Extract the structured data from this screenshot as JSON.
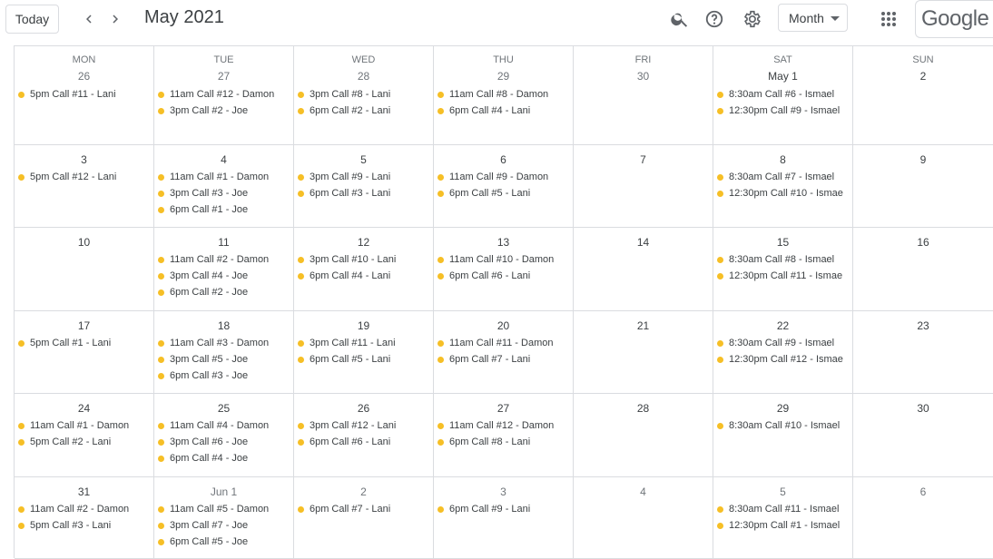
{
  "header": {
    "today_label": "Today",
    "title": "May 2021",
    "view_label": "Month",
    "logo_text": "Google",
    "prev_icon": "chevron-left-icon",
    "next_icon": "chevron-right-icon",
    "search_icon": "search-icon",
    "help_icon": "help-icon",
    "settings_icon": "gear-icon",
    "apps_icon": "apps-grid-icon"
  },
  "colors": {
    "event_dot": "#f6bf26",
    "grid_line": "#dadce0"
  },
  "weekdays": [
    "MON",
    "TUE",
    "WED",
    "THU",
    "FRI",
    "SAT",
    "SUN"
  ],
  "weeks": [
    {
      "days": [
        {
          "label": "26",
          "other": true,
          "events": [
            {
              "time": "5pm",
              "title": "Call #11 - Lani"
            }
          ]
        },
        {
          "label": "27",
          "other": true,
          "events": [
            {
              "time": "11am",
              "title": "Call #12 - Damon"
            },
            {
              "time": "3pm",
              "title": "Call #2 - Joe"
            }
          ]
        },
        {
          "label": "28",
          "other": true,
          "events": [
            {
              "time": "3pm",
              "title": "Call #8 - Lani"
            },
            {
              "time": "6pm",
              "title": "Call #2 - Lani"
            }
          ]
        },
        {
          "label": "29",
          "other": true,
          "events": [
            {
              "time": "11am",
              "title": "Call #8 - Damon"
            },
            {
              "time": "6pm",
              "title": "Call #4 - Lani"
            }
          ]
        },
        {
          "label": "30",
          "other": true,
          "events": []
        },
        {
          "label": "May 1",
          "other": false,
          "events": [
            {
              "time": "8:30am",
              "title": "Call #6 - Ismael"
            },
            {
              "time": "12:30pm",
              "title": "Call #9 - Ismael"
            }
          ]
        },
        {
          "label": "2",
          "other": false,
          "events": []
        }
      ]
    },
    {
      "days": [
        {
          "label": "3",
          "other": false,
          "events": [
            {
              "time": "5pm",
              "title": "Call #12 - Lani"
            }
          ]
        },
        {
          "label": "4",
          "other": false,
          "events": [
            {
              "time": "11am",
              "title": "Call #1 - Damon"
            },
            {
              "time": "3pm",
              "title": "Call #3 - Joe"
            },
            {
              "time": "6pm",
              "title": "Call #1 - Joe"
            }
          ]
        },
        {
          "label": "5",
          "other": false,
          "events": [
            {
              "time": "3pm",
              "title": "Call #9 - Lani"
            },
            {
              "time": "6pm",
              "title": "Call #3 - Lani"
            }
          ]
        },
        {
          "label": "6",
          "other": false,
          "events": [
            {
              "time": "11am",
              "title": "Call #9 - Damon"
            },
            {
              "time": "6pm",
              "title": "Call #5 - Lani"
            }
          ]
        },
        {
          "label": "7",
          "other": false,
          "events": []
        },
        {
          "label": "8",
          "other": false,
          "events": [
            {
              "time": "8:30am",
              "title": "Call #7 - Ismael"
            },
            {
              "time": "12:30pm",
              "title": "Call #10 - Ismae"
            }
          ]
        },
        {
          "label": "9",
          "other": false,
          "events": []
        }
      ]
    },
    {
      "days": [
        {
          "label": "10",
          "other": false,
          "events": []
        },
        {
          "label": "11",
          "other": false,
          "events": [
            {
              "time": "11am",
              "title": "Call #2 - Damon"
            },
            {
              "time": "3pm",
              "title": "Call #4 - Joe"
            },
            {
              "time": "6pm",
              "title": "Call #2 - Joe"
            }
          ]
        },
        {
          "label": "12",
          "other": false,
          "events": [
            {
              "time": "3pm",
              "title": "Call #10 - Lani"
            },
            {
              "time": "6pm",
              "title": "Call #4 - Lani"
            }
          ]
        },
        {
          "label": "13",
          "other": false,
          "events": [
            {
              "time": "11am",
              "title": "Call #10 - Damon"
            },
            {
              "time": "6pm",
              "title": "Call #6 - Lani"
            }
          ]
        },
        {
          "label": "14",
          "other": false,
          "events": []
        },
        {
          "label": "15",
          "other": false,
          "events": [
            {
              "time": "8:30am",
              "title": "Call #8 - Ismael"
            },
            {
              "time": "12:30pm",
              "title": "Call #11 - Ismae"
            }
          ]
        },
        {
          "label": "16",
          "other": false,
          "events": []
        }
      ]
    },
    {
      "days": [
        {
          "label": "17",
          "other": false,
          "events": [
            {
              "time": "5pm",
              "title": "Call #1 - Lani"
            }
          ]
        },
        {
          "label": "18",
          "other": false,
          "events": [
            {
              "time": "11am",
              "title": "Call #3 - Damon"
            },
            {
              "time": "3pm",
              "title": "Call #5 - Joe"
            },
            {
              "time": "6pm",
              "title": "Call #3 - Joe"
            }
          ]
        },
        {
          "label": "19",
          "other": false,
          "events": [
            {
              "time": "3pm",
              "title": "Call #11 - Lani"
            },
            {
              "time": "6pm",
              "title": "Call #5 - Lani"
            }
          ]
        },
        {
          "label": "20",
          "other": false,
          "events": [
            {
              "time": "11am",
              "title": "Call #11 - Damon"
            },
            {
              "time": "6pm",
              "title": "Call #7 - Lani"
            }
          ]
        },
        {
          "label": "21",
          "other": false,
          "events": []
        },
        {
          "label": "22",
          "other": false,
          "events": [
            {
              "time": "8:30am",
              "title": "Call #9 - Ismael"
            },
            {
              "time": "12:30pm",
              "title": "Call #12 - Ismae"
            }
          ]
        },
        {
          "label": "23",
          "other": false,
          "events": []
        }
      ]
    },
    {
      "days": [
        {
          "label": "24",
          "other": false,
          "events": [
            {
              "time": "11am",
              "title": "Call #1 - Damon"
            },
            {
              "time": "5pm",
              "title": "Call #2 - Lani"
            }
          ]
        },
        {
          "label": "25",
          "other": false,
          "events": [
            {
              "time": "11am",
              "title": "Call #4 - Damon"
            },
            {
              "time": "3pm",
              "title": "Call #6 - Joe"
            },
            {
              "time": "6pm",
              "title": "Call #4 - Joe"
            }
          ]
        },
        {
          "label": "26",
          "other": false,
          "events": [
            {
              "time": "3pm",
              "title": "Call #12 - Lani"
            },
            {
              "time": "6pm",
              "title": "Call #6 - Lani"
            }
          ]
        },
        {
          "label": "27",
          "other": false,
          "events": [
            {
              "time": "11am",
              "title": "Call #12 - Damon"
            },
            {
              "time": "6pm",
              "title": "Call #8 - Lani"
            }
          ]
        },
        {
          "label": "28",
          "other": false,
          "events": []
        },
        {
          "label": "29",
          "other": false,
          "events": [
            {
              "time": "8:30am",
              "title": "Call #10 - Ismael"
            }
          ]
        },
        {
          "label": "30",
          "other": false,
          "events": []
        }
      ]
    },
    {
      "days": [
        {
          "label": "31",
          "other": false,
          "events": [
            {
              "time": "11am",
              "title": "Call #2 - Damon"
            },
            {
              "time": "5pm",
              "title": "Call #3 - Lani"
            }
          ]
        },
        {
          "label": "Jun 1",
          "other": true,
          "events": [
            {
              "time": "11am",
              "title": "Call #5 - Damon"
            },
            {
              "time": "3pm",
              "title": "Call #7 - Joe"
            },
            {
              "time": "6pm",
              "title": "Call #5 - Joe"
            }
          ]
        },
        {
          "label": "2",
          "other": true,
          "events": [
            {
              "time": "6pm",
              "title": "Call #7 - Lani"
            }
          ]
        },
        {
          "label": "3",
          "other": true,
          "events": [
            {
              "time": "6pm",
              "title": "Call #9 - Lani"
            }
          ]
        },
        {
          "label": "4",
          "other": true,
          "events": []
        },
        {
          "label": "5",
          "other": true,
          "events": [
            {
              "time": "8:30am",
              "title": "Call #11 - Ismael"
            },
            {
              "time": "12:30pm",
              "title": "Call #1 - Ismael"
            }
          ]
        },
        {
          "label": "6",
          "other": true,
          "events": []
        }
      ]
    }
  ]
}
